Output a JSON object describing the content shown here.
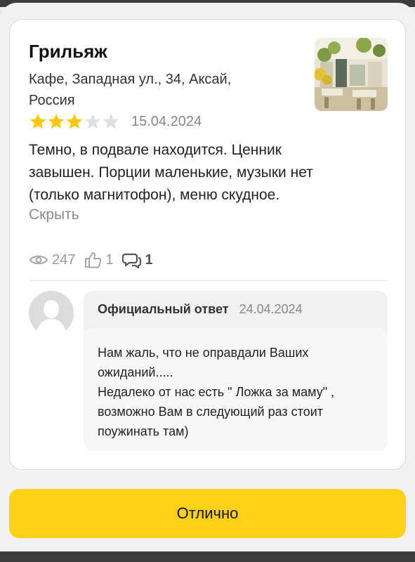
{
  "place": {
    "name": "Грильяж",
    "address_line1": "Кафе, Западная ул., 34, Аксай,",
    "address_line2": "Россия"
  },
  "review": {
    "rating": 3,
    "rating_max": 5,
    "date": "15.04.2024",
    "text_lines": [
      "Темно, в подвале находится. Ценник",
      "завышен. Порции маленькие, музыки нет",
      "(только магнитофон), меню скудное."
    ],
    "hide_label": "Скрыть"
  },
  "stats": {
    "views": "247",
    "likes": "1",
    "comments": "1"
  },
  "reply": {
    "title": "Официальный ответ",
    "date": "24.04.2024",
    "lines": [
      "Нам жаль, что не оправдали Ваших",
      "ожиданий.....",
      "Недалеко от нас есть \" Ложка за маму\" ,",
      "возможно Вам в следующий раз стоит",
      "поужинать там)"
    ]
  },
  "footer": {
    "button_label": "Отлично"
  },
  "colors": {
    "star_filled": "#fcc800",
    "star_empty": "#e0e0e0",
    "button": "#fcd117"
  }
}
